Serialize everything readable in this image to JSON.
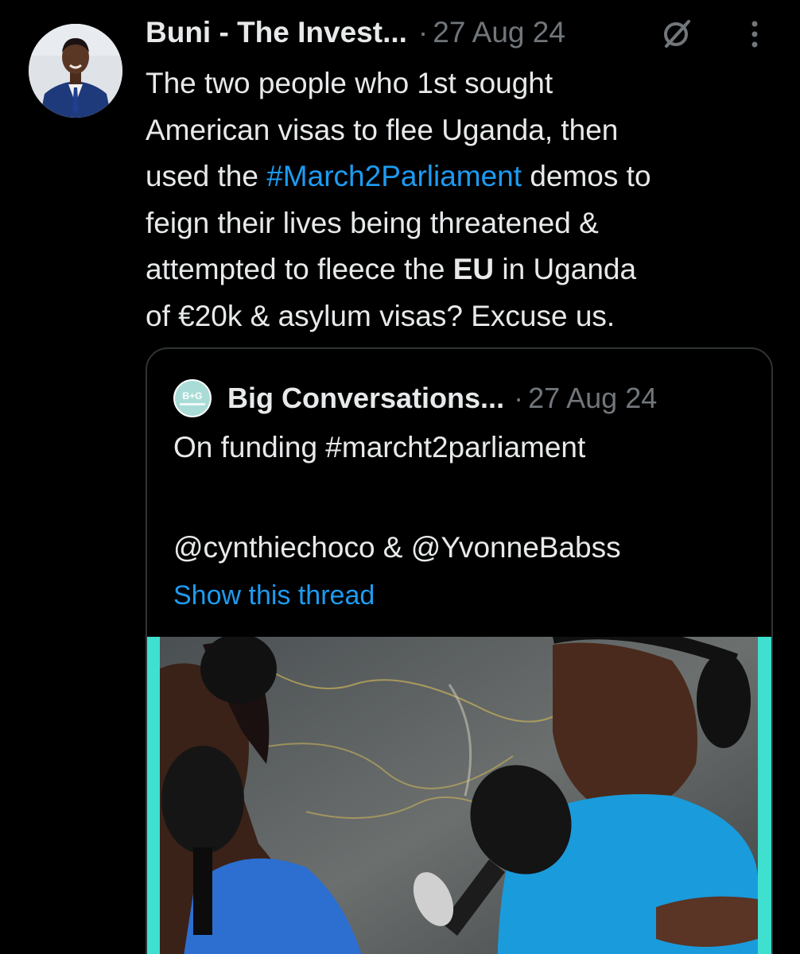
{
  "tweet": {
    "author": "Buni - The Invest...",
    "separator": "·",
    "timestamp": "27 Aug 24",
    "grok_icon": "grok-slash-circle-icon",
    "more_icon": "more-vertical-icon",
    "text": {
      "line1": "The two people who 1st sought",
      "line2": "American visas to flee Uganda, then",
      "line3_before": "used the ",
      "line3_hashtag": "#March2Parliament",
      "line3_after": " demos to",
      "line4": "feign their lives being threatened &",
      "line5_before": "attempted to fleece the ",
      "line5_bold": "EU",
      "line5_after": " in Uganda",
      "line6": "of €20k & asylum visas? Excuse us."
    }
  },
  "quoted_tweet": {
    "author": "Big Conversations...",
    "separator": "·",
    "timestamp": "27 Aug 24",
    "avatar_text": "B+G",
    "text_line1": "On funding #marcht2parliament",
    "text_line2": "@cynthiechoco  & @YvonneBabss",
    "show_thread": "Show this thread"
  },
  "colors": {
    "background": "#000000",
    "text": "#e7e9ea",
    "muted": "#71767b",
    "link": "#1d9bf0",
    "border": "#2f3336",
    "media_frame": "#3fe0d0"
  }
}
